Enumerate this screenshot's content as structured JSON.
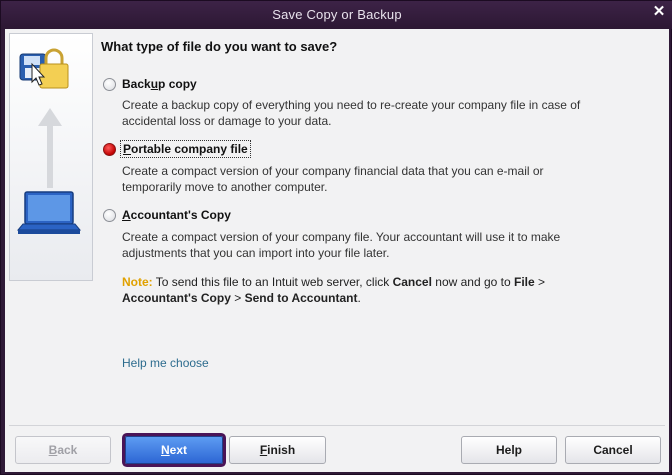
{
  "window": {
    "title": "Save Copy or Backup",
    "close_symbol": "✕"
  },
  "icons": [
    "floppy-disk-lock-icon",
    "upload-arrow-icon",
    "laptop-icon",
    "cursor-arrow-icon"
  ],
  "question": "What type of file do you want to save?",
  "options": [
    {
      "label_pre": "Back",
      "label_u": "u",
      "label_post": "p copy",
      "selected": false,
      "description": "Create a backup copy of everything you need to re-create your company file in case of accidental loss or damage to your data."
    },
    {
      "label_pre": "",
      "label_u": "P",
      "label_post": "ortable company file",
      "selected": true,
      "description": "Create a compact version of your company financial data that you can e-mail or temporarily move to another computer."
    },
    {
      "label_pre": "",
      "label_u": "A",
      "label_post": "ccountant's Copy",
      "selected": false,
      "description": "Create a compact version of your company file. Your accountant will use it to make adjustments that you can import into your file later."
    }
  ],
  "note": {
    "label": "Note:",
    "t1": " To send this file to an Intuit web server, click ",
    "cancel": "Cancel",
    "t2": " now and go to ",
    "file": "File",
    "t3": " > ",
    "accountants_copy": "Accountant's Copy",
    "t4": " > ",
    "send": "Send to Accountant",
    "t5": "."
  },
  "help_link": "Help me choose",
  "buttons": {
    "back": {
      "pre": "",
      "u": "B",
      "post": "ack",
      "enabled": false
    },
    "next": {
      "pre": "",
      "u": "N",
      "post": "ext",
      "enabled": true
    },
    "finish": {
      "pre": "",
      "u": "F",
      "post": "inish",
      "enabled": true
    },
    "help": {
      "label": "Help"
    },
    "cancel": {
      "label": "Cancel"
    }
  },
  "colors": {
    "title_bar": "#2f1a37",
    "selected_radio": "#c00000",
    "note_label": "#e0a100",
    "link": "#2d6c8e",
    "primary_button": "#2d66d4",
    "primary_focus_ring": "#4a1457"
  }
}
